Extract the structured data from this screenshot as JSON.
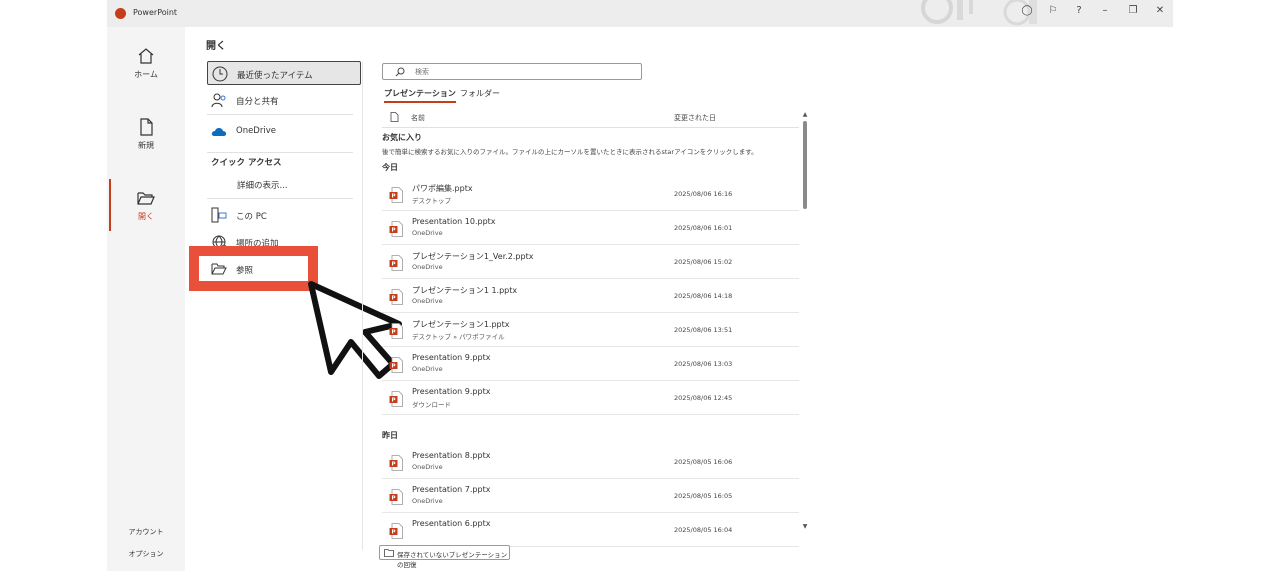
{
  "window": {
    "title": "PowerPoint"
  },
  "rail": {
    "items": [
      {
        "label": "ホーム",
        "icon": "home-icon"
      },
      {
        "label": "新規",
        "icon": "new-file-icon"
      },
      {
        "label": "開く",
        "icon": "folder-open-icon",
        "active": true
      }
    ],
    "footer": [
      "アカウント",
      "オプション"
    ]
  },
  "open_panel": {
    "title": "開く",
    "locations": [
      {
        "label": "最近使ったアイテム",
        "icon": "clock-icon",
        "active": true
      },
      {
        "label": "自分と共有",
        "icon": "people-icon"
      },
      {
        "label": "OneDrive",
        "icon": "cloud-icon"
      }
    ],
    "quick_access_label": "クイック アクセス",
    "details_label": "詳細の表示...",
    "other_locations": [
      {
        "label": "この PC",
        "icon": "pc-icon"
      },
      {
        "label": "場所の追加",
        "icon": "globe-icon"
      },
      {
        "label": "参照",
        "icon": "folder-icon"
      }
    ]
  },
  "files": {
    "search_placeholder": "検索",
    "tabs": [
      "プレゼンテーション",
      "フォルダー"
    ],
    "columns": {
      "name": "名前",
      "modified": "変更された日"
    },
    "favorites": {
      "label": "お気に入り",
      "description": "後で簡単に検索するお気に入りのファイル。ファイルの上にカーソルを置いたときに表示されるstarアイコンをクリックします。"
    },
    "groups": [
      {
        "label": "今日",
        "items": [
          {
            "name": "パワポ編集.pptx",
            "location": "デスクトップ",
            "date": "2025/08/06 16:16"
          },
          {
            "name": "Presentation 10.pptx",
            "location": "OneDrive",
            "date": "2025/08/06 16:01"
          },
          {
            "name": "プレゼンテーション1_Ver.2.pptx",
            "location": "OneDrive",
            "date": "2025/08/06 15:02"
          },
          {
            "name": "プレゼンテーション1 1.pptx",
            "location": "OneDrive",
            "date": "2025/08/06 14:18"
          },
          {
            "name": "プレゼンテーション1.pptx",
            "location": "デスクトップ » パワポファイル",
            "date": "2025/08/06 13:51"
          },
          {
            "name": "Presentation 9.pptx",
            "location": "OneDrive",
            "date": "2025/08/06 13:03"
          },
          {
            "name": "Presentation 9.pptx",
            "location": "ダウンロード",
            "date": "2025/08/06 12:45"
          }
        ]
      },
      {
        "label": "昨日",
        "items": [
          {
            "name": "Presentation 8.pptx",
            "location": "OneDrive",
            "date": "2025/08/05 16:06"
          },
          {
            "name": "Presentation 7.pptx",
            "location": "OneDrive",
            "date": "2025/08/05 16:05"
          },
          {
            "name": "Presentation 6.pptx",
            "location": "",
            "date": "2025/08/05 16:04"
          }
        ]
      }
    ],
    "recover_button": "保存されていないプレゼンテーションの回復"
  },
  "colors": {
    "accent": "#c43e1c",
    "highlight": "#e8503a"
  }
}
